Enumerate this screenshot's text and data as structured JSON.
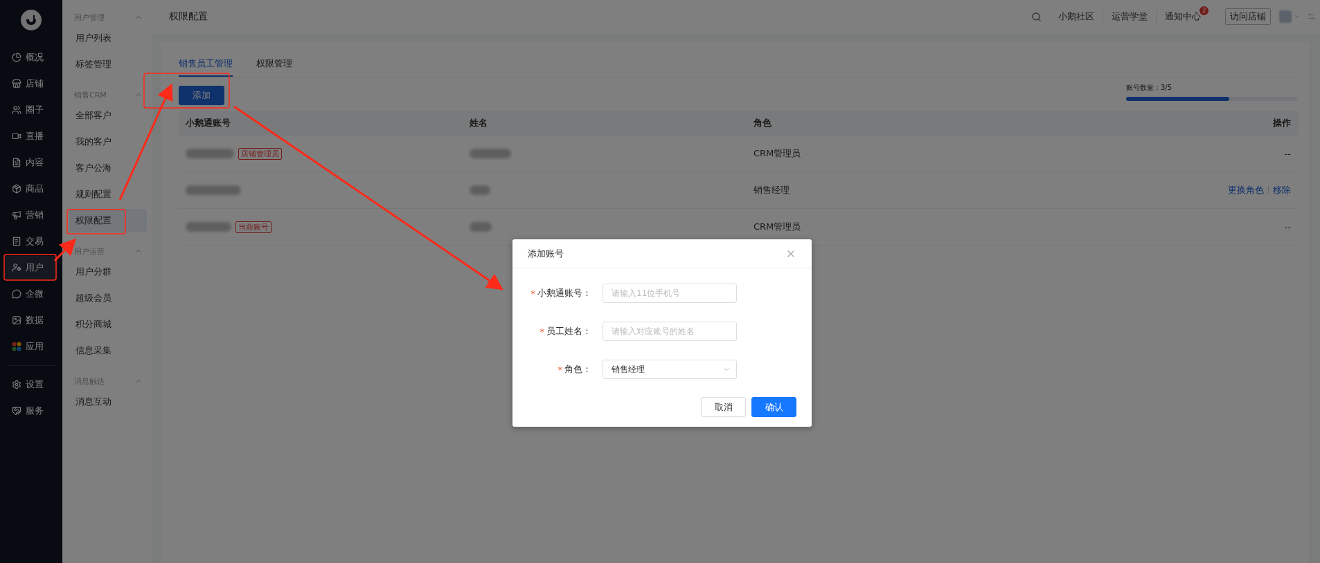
{
  "nav": [
    {
      "label": "概况",
      "selected": false
    },
    {
      "label": "店铺",
      "selected": false
    },
    {
      "label": "圈子",
      "selected": false
    },
    {
      "label": "直播",
      "selected": false
    },
    {
      "label": "内容",
      "selected": false
    },
    {
      "label": "商品",
      "selected": false
    },
    {
      "label": "营销",
      "selected": false
    },
    {
      "label": "交易",
      "selected": false
    },
    {
      "label": "用户",
      "selected": true
    },
    {
      "label": "企微",
      "selected": false
    },
    {
      "label": "数据",
      "selected": false
    },
    {
      "label": "应用",
      "selected": false
    }
  ],
  "nav_bottom": [
    {
      "label": "设置",
      "selected": false
    },
    {
      "label": "服务",
      "selected": false
    }
  ],
  "submenu": [
    {
      "title": "用户管理",
      "expanded": true,
      "items": [
        {
          "label": "用户列表",
          "selected": false
        },
        {
          "label": "标签管理",
          "selected": false
        }
      ]
    },
    {
      "title": "销售CRM",
      "expanded": true,
      "items": [
        {
          "label": "全部客户",
          "selected": false
        },
        {
          "label": "我的客户",
          "selected": false
        },
        {
          "label": "客户公海",
          "selected": false
        },
        {
          "label": "规则配置",
          "selected": false
        },
        {
          "label": "权限配置",
          "selected": true
        }
      ]
    },
    {
      "title": "用户运营",
      "expanded": true,
      "items": [
        {
          "label": "用户分群",
          "selected": false
        },
        {
          "label": "超级会员",
          "selected": false
        },
        {
          "label": "积分商城",
          "selected": false
        },
        {
          "label": "信息采集",
          "selected": false
        }
      ]
    },
    {
      "title": "消息触达",
      "expanded": true,
      "items": [
        {
          "label": "消息互动",
          "selected": false
        }
      ]
    }
  ],
  "header": {
    "title": "权限配置",
    "links": [
      "小鹅社区",
      "运营学堂",
      "通知中心"
    ],
    "notification_count": "2",
    "visit_button": "访问店铺"
  },
  "tabs": [
    {
      "label": "销售员工管理",
      "selected": true
    },
    {
      "label": "权限管理",
      "selected": false
    }
  ],
  "add_button": "添加",
  "quota": {
    "label": "账号数量：3/5",
    "level": 0.6
  },
  "table": {
    "columns": [
      "小鹅通账号",
      "姓名",
      "角色",
      "操作"
    ],
    "rows": [
      {
        "tag": "店铺管理员",
        "role": "CRM管理员",
        "actions": [],
        "action_text": "--"
      },
      {
        "role": "销售经理",
        "actions": [
          "更换角色",
          "移除"
        ]
      },
      {
        "tag": "当前账号",
        "role": "CRM管理员",
        "actions": [],
        "action_text": "--"
      }
    ]
  },
  "dialog": {
    "title": "添加账号",
    "required_mark": "*",
    "fields": [
      {
        "kind": "input",
        "label": "小鹅通账号：",
        "required": true,
        "placeholder": "请输入11位手机号"
      },
      {
        "kind": "input",
        "label": "员工姓名：",
        "required": true,
        "placeholder": "请输入对应账号的姓名"
      },
      {
        "kind": "select",
        "label": "角色：",
        "required": true,
        "value": "销售经理"
      }
    ],
    "buttons": [
      {
        "label": "取消",
        "kind": "secondary"
      },
      {
        "label": "确认",
        "kind": "primary"
      }
    ]
  }
}
